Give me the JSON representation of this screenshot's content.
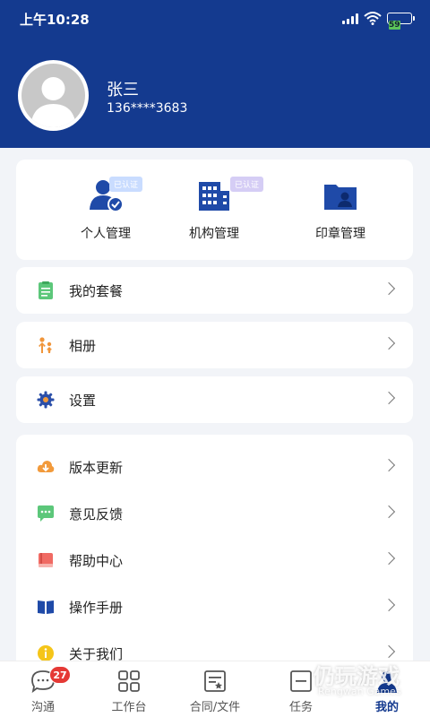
{
  "status": {
    "time": "上午10:28",
    "battery": "59"
  },
  "profile": {
    "name": "张三",
    "phone": "136****3683"
  },
  "quick_actions": [
    {
      "label": "个人管理",
      "icon": "person-verified-icon",
      "badge": "已认证"
    },
    {
      "label": "机构管理",
      "icon": "building-icon",
      "badge": "已认证"
    },
    {
      "label": "印章管理",
      "icon": "seal-folder-icon"
    }
  ],
  "menu_group_1": [
    {
      "label": "我的套餐",
      "icon": "package-list-icon"
    }
  ],
  "menu_group_2": [
    {
      "label": "相册",
      "icon": "album-people-icon"
    }
  ],
  "menu_group_3": [
    {
      "label": "设置",
      "icon": "gear-icon"
    }
  ],
  "menu_group_4": [
    {
      "label": "版本更新",
      "icon": "cloud-download-icon"
    },
    {
      "label": "意见反馈",
      "icon": "chat-feedback-icon"
    },
    {
      "label": "帮助中心",
      "icon": "book-help-icon"
    },
    {
      "label": "操作手册",
      "icon": "open-book-icon"
    },
    {
      "label": "关于我们",
      "icon": "info-icon"
    }
  ],
  "bottom_nav": [
    {
      "label": "沟通",
      "icon": "chat-bubble-icon",
      "badge": "27"
    },
    {
      "label": "工作台",
      "icon": "grid-icon"
    },
    {
      "label": "合同/文件",
      "icon": "contract-doc-icon"
    },
    {
      "label": "任务",
      "icon": "task-icon"
    },
    {
      "label": "我的",
      "icon": "profile-icon",
      "active": true
    }
  ],
  "watermark": {
    "text": "仍玩游戏",
    "sub": "Rengwan Games"
  },
  "colors": {
    "header": "#143a8f",
    "accent": "#1f4aa8",
    "badge_red": "#e53935",
    "verified_bg": "#c9dcff",
    "verified_bg_alt": "#d5cdf5"
  }
}
